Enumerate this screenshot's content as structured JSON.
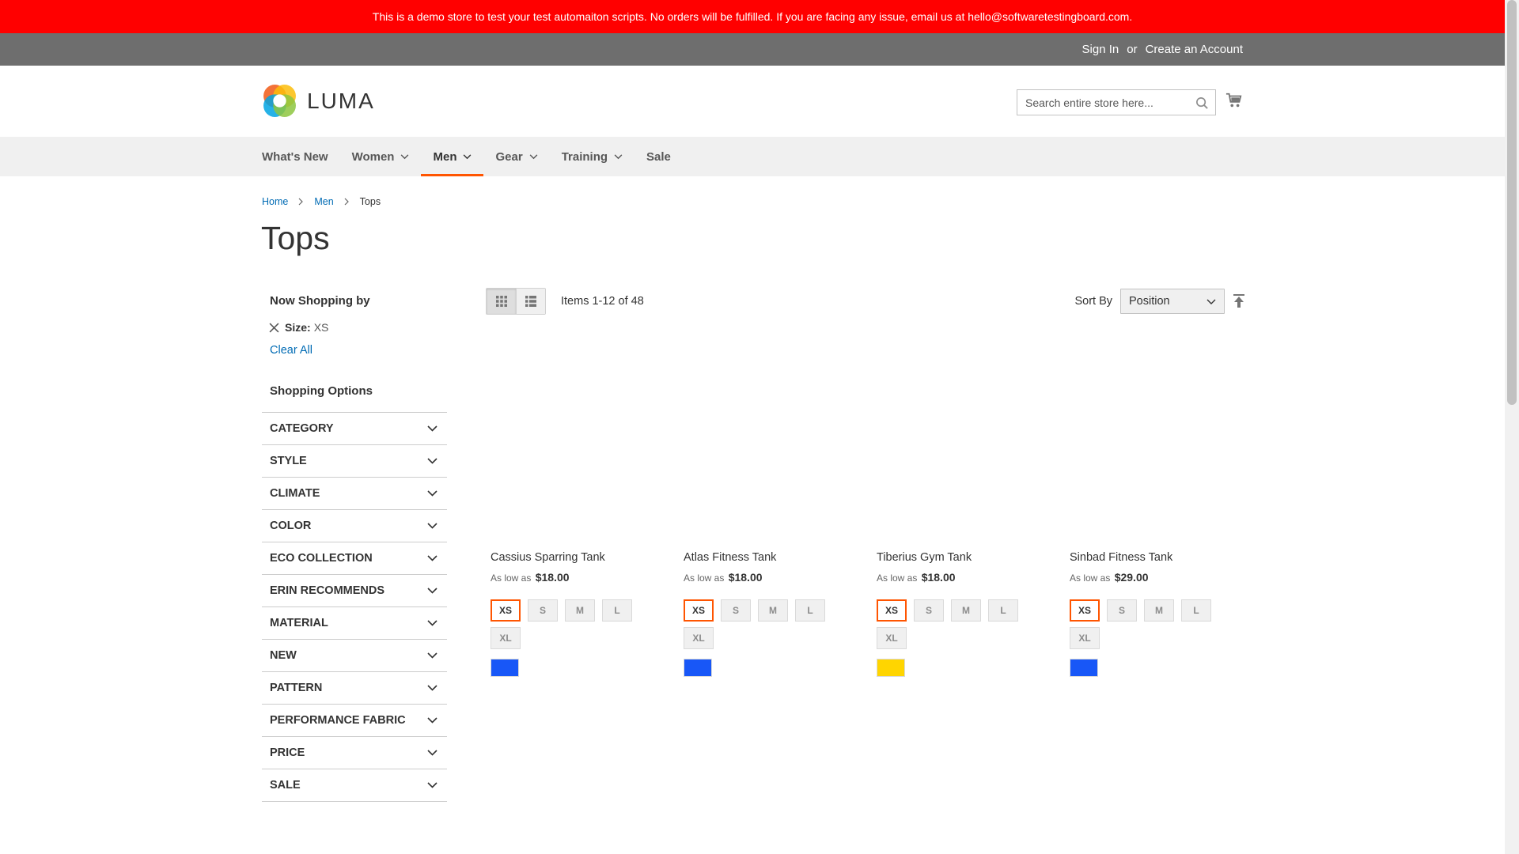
{
  "banner": {
    "text": "This is a demo store to test your test automaiton scripts. No orders will be fulfilled. If you are facing any issue, email us at hello@softwaretestingboard.com."
  },
  "panel": {
    "sign_in": "Sign In",
    "or": "or",
    "create_account": "Create an Account"
  },
  "header": {
    "logo_text": "LUMA",
    "search_placeholder": "Search entire store here...",
    "logo_colors": [
      "#f26322",
      "#fbbd0a",
      "#8dc63f",
      "#00a5e3",
      "#1979c3"
    ]
  },
  "nav": {
    "items": [
      {
        "label": "What's New",
        "has_dropdown": false
      },
      {
        "label": "Women",
        "has_dropdown": true
      },
      {
        "label": "Men",
        "has_dropdown": true,
        "active": true
      },
      {
        "label": "Gear",
        "has_dropdown": true
      },
      {
        "label": "Training",
        "has_dropdown": true
      },
      {
        "label": "Sale",
        "has_dropdown": false
      }
    ]
  },
  "breadcrumb": {
    "items": [
      "Home",
      "Men"
    ],
    "current": "Tops"
  },
  "page_title": "Tops",
  "sidebar": {
    "now_shopping_title": "Now Shopping by",
    "active_filter": {
      "label": "Size:",
      "value": "XS"
    },
    "clear_all": "Clear All",
    "shopping_options_title": "Shopping Options",
    "options": [
      "CATEGORY",
      "STYLE",
      "CLIMATE",
      "COLOR",
      "ECO COLLECTION",
      "ERIN RECOMMENDS",
      "MATERIAL",
      "NEW",
      "PATTERN",
      "PERFORMANCE FABRIC",
      "PRICE",
      "SALE"
    ]
  },
  "toolbar": {
    "amount": "Items 1-12 of 48",
    "sort_label": "Sort By",
    "sort_value": "Position"
  },
  "products": [
    {
      "name": "Cassius Sparring Tank",
      "price_prefix": "As low as",
      "price": "$18.00",
      "sizes": [
        "XS",
        "S",
        "M",
        "L",
        "XL"
      ],
      "selected_size": "XS",
      "color": "#1857f7"
    },
    {
      "name": "Atlas Fitness Tank",
      "price_prefix": "As low as",
      "price": "$18.00",
      "sizes": [
        "XS",
        "S",
        "M",
        "L",
        "XL"
      ],
      "selected_size": "XS",
      "color": "#1857f7"
    },
    {
      "name": "Tiberius Gym Tank",
      "price_prefix": "As low as",
      "price": "$18.00",
      "sizes": [
        "XS",
        "S",
        "M",
        "L",
        "XL"
      ],
      "selected_size": "XS",
      "color": "#ffd500"
    },
    {
      "name": "Sinbad Fitness Tank",
      "price_prefix": "As low as",
      "price": "$29.00",
      "sizes": [
        "XS",
        "S",
        "M",
        "L",
        "XL"
      ],
      "selected_size": "XS",
      "color": "#1857f7"
    }
  ],
  "colors": {
    "accent": "#ff5501",
    "link": "#006bb4",
    "banner": "#ff0000",
    "panel": "#6e6e6e"
  }
}
